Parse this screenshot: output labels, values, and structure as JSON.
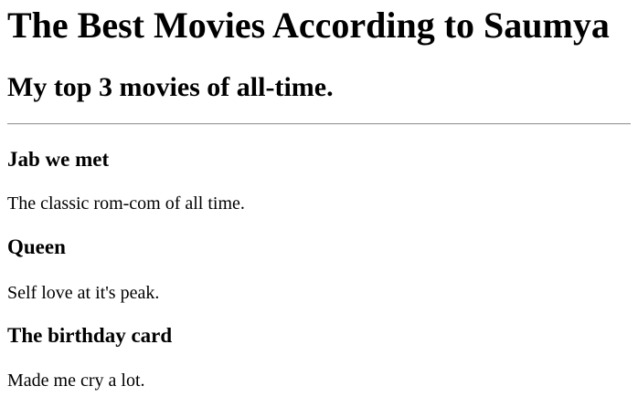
{
  "title": "The Best Movies According to Saumya",
  "subtitle": "My top 3 movies of all-time.",
  "movies": [
    {
      "name": "Jab we met",
      "description": "The classic rom-com of all time."
    },
    {
      "name": "Queen",
      "description": "Self love at it's peak."
    },
    {
      "name": "The birthday card",
      "description": "Made me cry a lot."
    }
  ]
}
